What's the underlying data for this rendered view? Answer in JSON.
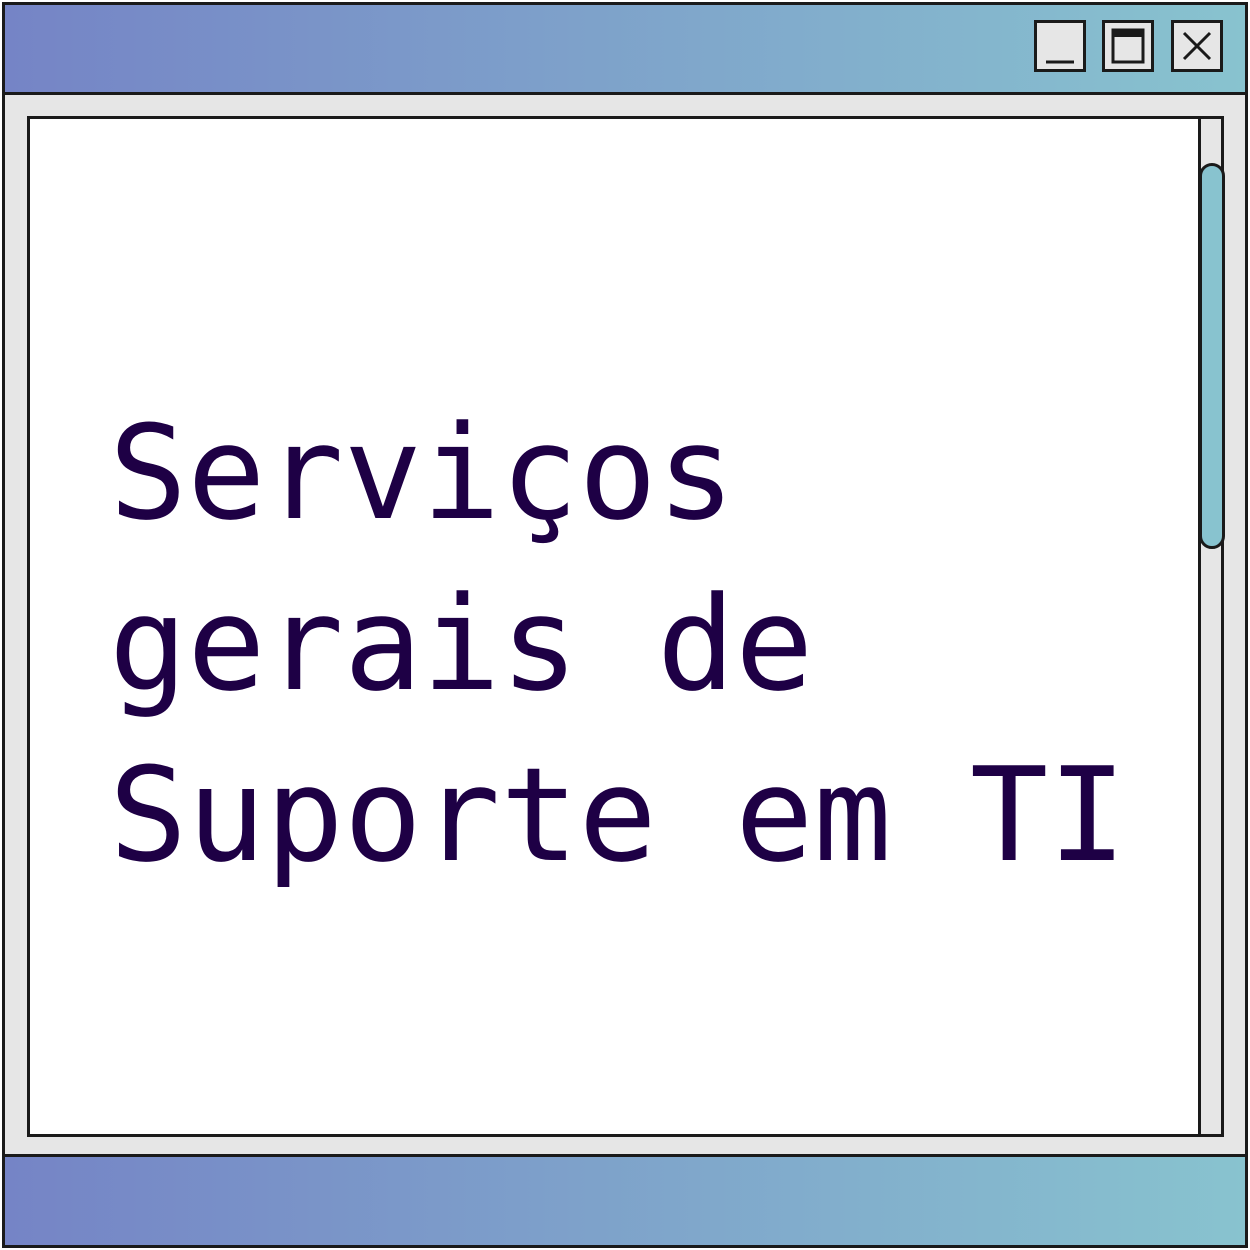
{
  "window": {
    "headline_lines": [
      "Serviços",
      "gerais de",
      "Suporte em TI"
    ]
  },
  "colors": {
    "gradient_start": "#7584c6",
    "gradient_end": "#88c3cf",
    "text": "#1e0045",
    "frame": "#e6e6e6",
    "scroll_thumb": "#88c3cf"
  },
  "icons": {
    "minimize": "minimize-icon",
    "maximize": "maximize-icon",
    "close": "close-icon"
  }
}
